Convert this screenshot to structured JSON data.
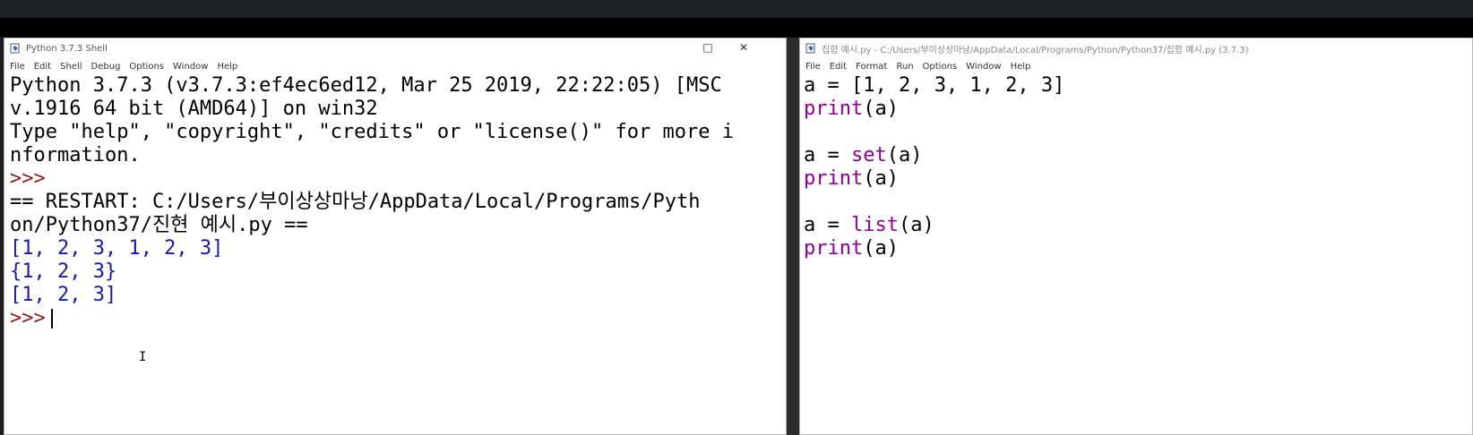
{
  "shell": {
    "title": "Python 3.7.3 Shell",
    "menu": [
      "File",
      "Edit",
      "Shell",
      "Debug",
      "Options",
      "Window",
      "Help"
    ],
    "controls": {
      "maximize": "□",
      "close": "✕"
    },
    "banner": [
      "Python 3.7.3 (v3.7.3:ef4ec6ed12, Mar 25 2019, 22:22:05) [MSC",
      "v.1916 64 bit (AMD64)] on win32",
      "Type \"help\", \"copyright\", \"credits\" or \"license()\" for more i",
      "nformation."
    ],
    "prompt": ">>>",
    "restart": [
      "== RESTART: C:/Users/부이상상마낭/AppData/Local/Programs/Pyth",
      "on/Python37/진현 예시.py =="
    ],
    "outputs": [
      "[1, 2, 3, 1, 2, 3]",
      "{1, 2, 3}",
      "[1, 2, 3]"
    ],
    "cursor_icon": "I"
  },
  "editor": {
    "title": "집합 예시.py - C:/Users/부이상상마낭/AppData/Local/Programs/Python/Python37/집합 예시.py (3.7.3)",
    "menu": [
      "File",
      "Edit",
      "Format",
      "Run",
      "Options",
      "Window",
      "Help"
    ],
    "lines": {
      "l1": "a = [1, 2, 3, 1, 2, 3]",
      "l2_kw": "print",
      "l2_rest": "(a)",
      "l4_pre": "a = ",
      "l4_kw": "set",
      "l4_rest": "(a)",
      "l5_kw": "print",
      "l5_rest": "(a)",
      "l7_pre": "a = ",
      "l7_kw": "list",
      "l7_rest": "(a)",
      "l8_kw": "print",
      "l8_rest": "(a)"
    }
  }
}
